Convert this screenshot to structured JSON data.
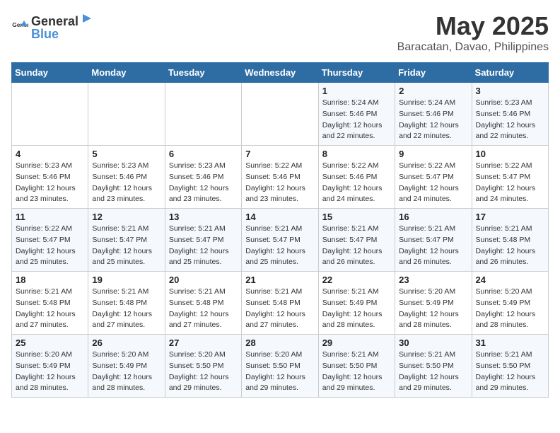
{
  "header": {
    "logo_general": "General",
    "logo_blue": "Blue",
    "month": "May 2025",
    "location": "Baracatan, Davao, Philippines"
  },
  "days_of_week": [
    "Sunday",
    "Monday",
    "Tuesday",
    "Wednesday",
    "Thursday",
    "Friday",
    "Saturday"
  ],
  "weeks": [
    [
      {
        "day": "",
        "info": ""
      },
      {
        "day": "",
        "info": ""
      },
      {
        "day": "",
        "info": ""
      },
      {
        "day": "",
        "info": ""
      },
      {
        "day": "1",
        "info": "Sunrise: 5:24 AM\nSunset: 5:46 PM\nDaylight: 12 hours\nand 22 minutes."
      },
      {
        "day": "2",
        "info": "Sunrise: 5:24 AM\nSunset: 5:46 PM\nDaylight: 12 hours\nand 22 minutes."
      },
      {
        "day": "3",
        "info": "Sunrise: 5:23 AM\nSunset: 5:46 PM\nDaylight: 12 hours\nand 22 minutes."
      }
    ],
    [
      {
        "day": "4",
        "info": "Sunrise: 5:23 AM\nSunset: 5:46 PM\nDaylight: 12 hours\nand 23 minutes."
      },
      {
        "day": "5",
        "info": "Sunrise: 5:23 AM\nSunset: 5:46 PM\nDaylight: 12 hours\nand 23 minutes."
      },
      {
        "day": "6",
        "info": "Sunrise: 5:23 AM\nSunset: 5:46 PM\nDaylight: 12 hours\nand 23 minutes."
      },
      {
        "day": "7",
        "info": "Sunrise: 5:22 AM\nSunset: 5:46 PM\nDaylight: 12 hours\nand 23 minutes."
      },
      {
        "day": "8",
        "info": "Sunrise: 5:22 AM\nSunset: 5:46 PM\nDaylight: 12 hours\nand 24 minutes."
      },
      {
        "day": "9",
        "info": "Sunrise: 5:22 AM\nSunset: 5:47 PM\nDaylight: 12 hours\nand 24 minutes."
      },
      {
        "day": "10",
        "info": "Sunrise: 5:22 AM\nSunset: 5:47 PM\nDaylight: 12 hours\nand 24 minutes."
      }
    ],
    [
      {
        "day": "11",
        "info": "Sunrise: 5:22 AM\nSunset: 5:47 PM\nDaylight: 12 hours\nand 25 minutes."
      },
      {
        "day": "12",
        "info": "Sunrise: 5:21 AM\nSunset: 5:47 PM\nDaylight: 12 hours\nand 25 minutes."
      },
      {
        "day": "13",
        "info": "Sunrise: 5:21 AM\nSunset: 5:47 PM\nDaylight: 12 hours\nand 25 minutes."
      },
      {
        "day": "14",
        "info": "Sunrise: 5:21 AM\nSunset: 5:47 PM\nDaylight: 12 hours\nand 25 minutes."
      },
      {
        "day": "15",
        "info": "Sunrise: 5:21 AM\nSunset: 5:47 PM\nDaylight: 12 hours\nand 26 minutes."
      },
      {
        "day": "16",
        "info": "Sunrise: 5:21 AM\nSunset: 5:47 PM\nDaylight: 12 hours\nand 26 minutes."
      },
      {
        "day": "17",
        "info": "Sunrise: 5:21 AM\nSunset: 5:48 PM\nDaylight: 12 hours\nand 26 minutes."
      }
    ],
    [
      {
        "day": "18",
        "info": "Sunrise: 5:21 AM\nSunset: 5:48 PM\nDaylight: 12 hours\nand 27 minutes."
      },
      {
        "day": "19",
        "info": "Sunrise: 5:21 AM\nSunset: 5:48 PM\nDaylight: 12 hours\nand 27 minutes."
      },
      {
        "day": "20",
        "info": "Sunrise: 5:21 AM\nSunset: 5:48 PM\nDaylight: 12 hours\nand 27 minutes."
      },
      {
        "day": "21",
        "info": "Sunrise: 5:21 AM\nSunset: 5:48 PM\nDaylight: 12 hours\nand 27 minutes."
      },
      {
        "day": "22",
        "info": "Sunrise: 5:21 AM\nSunset: 5:49 PM\nDaylight: 12 hours\nand 28 minutes."
      },
      {
        "day": "23",
        "info": "Sunrise: 5:20 AM\nSunset: 5:49 PM\nDaylight: 12 hours\nand 28 minutes."
      },
      {
        "day": "24",
        "info": "Sunrise: 5:20 AM\nSunset: 5:49 PM\nDaylight: 12 hours\nand 28 minutes."
      }
    ],
    [
      {
        "day": "25",
        "info": "Sunrise: 5:20 AM\nSunset: 5:49 PM\nDaylight: 12 hours\nand 28 minutes."
      },
      {
        "day": "26",
        "info": "Sunrise: 5:20 AM\nSunset: 5:49 PM\nDaylight: 12 hours\nand 28 minutes."
      },
      {
        "day": "27",
        "info": "Sunrise: 5:20 AM\nSunset: 5:50 PM\nDaylight: 12 hours\nand 29 minutes."
      },
      {
        "day": "28",
        "info": "Sunrise: 5:20 AM\nSunset: 5:50 PM\nDaylight: 12 hours\nand 29 minutes."
      },
      {
        "day": "29",
        "info": "Sunrise: 5:21 AM\nSunset: 5:50 PM\nDaylight: 12 hours\nand 29 minutes."
      },
      {
        "day": "30",
        "info": "Sunrise: 5:21 AM\nSunset: 5:50 PM\nDaylight: 12 hours\nand 29 minutes."
      },
      {
        "day": "31",
        "info": "Sunrise: 5:21 AM\nSunset: 5:50 PM\nDaylight: 12 hours\nand 29 minutes."
      }
    ]
  ]
}
